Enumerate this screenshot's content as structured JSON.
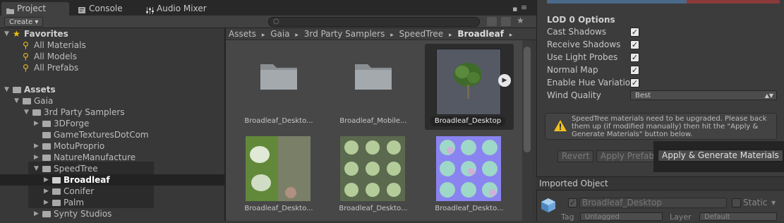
{
  "tabs": [
    {
      "label": "Project",
      "icon": "folder-icon",
      "active": true
    },
    {
      "label": "Console",
      "icon": "console-icon",
      "active": false
    },
    {
      "label": "Audio Mixer",
      "icon": "mixer-icon",
      "active": false
    }
  ],
  "toolbar": {
    "create_label": "Create",
    "create_caret": "▾",
    "search_placeholder": ""
  },
  "tree": {
    "favorites": {
      "label": "Favorites",
      "items": [
        "All Materials",
        "All Models",
        "All Prefabs"
      ]
    },
    "assets": {
      "label": "Assets"
    },
    "gaia": "Gaia",
    "third_party": "3rd Party Samplers",
    "third_party_children": [
      "3DForge",
      "GameTexturesDotCom",
      "MotuProprio",
      "NatureManufacture"
    ],
    "speedtree": "SpeedTree",
    "speedtree_children": [
      "Broadleaf",
      "Conifer",
      "Palm"
    ],
    "synty": "Synty Studios"
  },
  "breadcrumb": {
    "items": [
      "Assets",
      "Gaia",
      "3rd Party Samplers",
      "SpeedTree"
    ],
    "current": "Broadleaf",
    "separator": "▸"
  },
  "assets": [
    {
      "name": "Broadleaf_Deskto...",
      "kind": "folder"
    },
    {
      "name": "Broadleaf_Mobile...",
      "kind": "folder"
    },
    {
      "name": "Broadleaf_Desktop",
      "kind": "prefab",
      "selected": true
    },
    {
      "name": "Broadleaf_Deskto...",
      "kind": "texture-bark"
    },
    {
      "name": "Broadleaf_Deskto...",
      "kind": "texture-leaves"
    },
    {
      "name": "Broadleaf_Deskto...",
      "kind": "texture-normal"
    }
  ],
  "inspector": {
    "section_title": "LOD 0 Options",
    "options": [
      {
        "label": "Cast Shadows",
        "checked": true
      },
      {
        "label": "Receive Shadows",
        "checked": true
      },
      {
        "label": "Use Light Probes",
        "checked": true
      },
      {
        "label": "Normal Map",
        "checked": true
      },
      {
        "label": "Enable Hue Variatio",
        "checked": true
      }
    ],
    "wind_quality_label": "Wind Quality",
    "wind_quality_value": "Best",
    "warning_text": "SpeedTree materials need to be upgraded. Please back them up (if modified manually) then hit the \"Apply & Generate Materials\" button below.",
    "revert_label": "Revert",
    "apply_prefab_label": "Apply Prefab",
    "apply_generate_label": "Apply & Generate Materials",
    "imported_object_label": "Imported Object",
    "object_name": "Broadleaf_Desktop",
    "static_label": "Static",
    "tag_label": "Tag",
    "tag_value": "Untagged",
    "layer_label": "Layer",
    "layer_value": "Default"
  },
  "colors": {
    "accent_selected": "#222222",
    "warning_yellow": "#f0c020",
    "favorites_star": "#f5c400"
  }
}
